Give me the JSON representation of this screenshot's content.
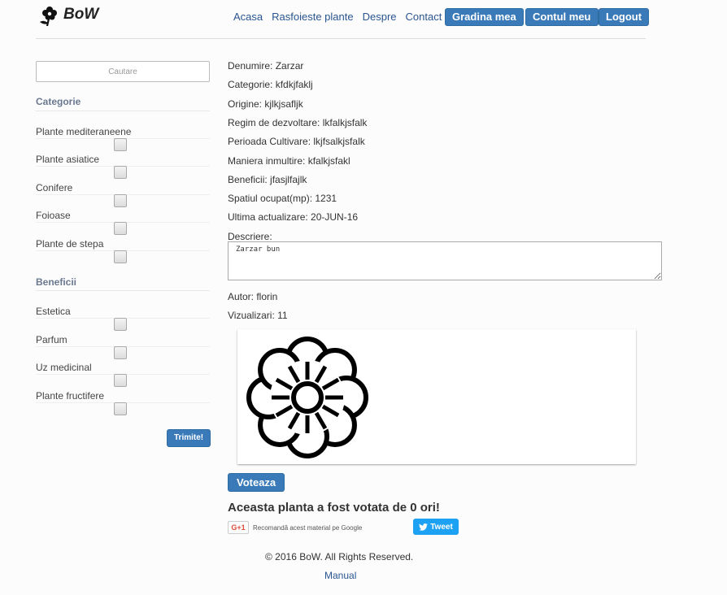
{
  "header": {
    "logo_text": "BoW",
    "logo_icon": "flower-icon",
    "nav_links": [
      "Acasa",
      "Rasfoieste plante",
      "Despre",
      "Contact"
    ],
    "buttons": [
      "Gradina mea",
      "Contul meu",
      "Logout"
    ]
  },
  "sidebar": {
    "search_placeholder": "Cautare",
    "categorie_title": "Categorie",
    "categorie_items": [
      {
        "label": "Plante mediteraneene",
        "checked": false
      },
      {
        "label": "Plante asiatice",
        "checked": false
      },
      {
        "label": "Conifere",
        "checked": false
      },
      {
        "label": "Foioase",
        "checked": false
      },
      {
        "label": "Plante de stepa",
        "checked": false
      }
    ],
    "beneficii_title": "Beneficii",
    "beneficii_items": [
      {
        "label": "Estetica",
        "checked": false
      },
      {
        "label": "Parfum",
        "checked": false
      },
      {
        "label": "Uz medicinal",
        "checked": false
      },
      {
        "label": "Plante fructifere",
        "checked": false
      }
    ],
    "submit_label": "Trimite!"
  },
  "plant": {
    "fields": [
      "Denumire: Zarzar",
      "Categorie: kfdkjfaklj",
      "Origine: kjlkjsafljk",
      "Regim de dezvoltare: lkfalkjsfalk",
      "Perioada Cultivare: lkjfsalkjsfalk",
      "Maniera inmultire: kfalkjsfakl",
      "Beneficii: jfasjlfajlk",
      "Spatiul ocupat(mp): 1231",
      "Ultima actualizare: 20-JUN-16"
    ],
    "descriere_label": "Descriere:",
    "descriere_value": "Zarzar bun",
    "autor": "Autor: florin",
    "vizualizari": "Vizualizari: 11",
    "image_icon": "flower-icon"
  },
  "vote": {
    "button_label": "Voteaza",
    "result_text": "Aceasta planta a fost votata de 0 ori!"
  },
  "social": {
    "gplus_badge": "G+1",
    "gplus_text": "Recomandă acest material pe Google",
    "tweet_label": "Tweet"
  },
  "footer": {
    "copyright": "© 2016 BoW. All Rights Reserved.",
    "manual_link": "Manual"
  }
}
